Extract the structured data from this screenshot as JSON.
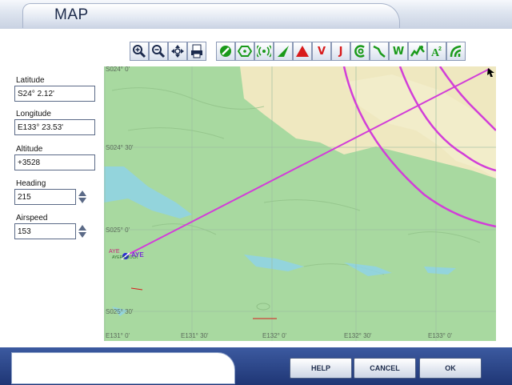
{
  "window": {
    "title": "MAP"
  },
  "toolbar": {
    "buttons": [
      {
        "name": "zoom-in-icon"
      },
      {
        "name": "zoom-out-icon"
      },
      {
        "name": "center-aircraft-icon"
      },
      {
        "name": "print-icon"
      },
      {
        "name": "airport-filter-icon",
        "color": "#1a9a1a"
      },
      {
        "name": "vor-filter-icon",
        "color": "#1a9a1a"
      },
      {
        "name": "ndb-filter-icon",
        "color": "#1a9a1a"
      },
      {
        "name": "ils-filter-icon",
        "color": "#1a9a1a"
      },
      {
        "name": "intersection-filter-icon",
        "color": "#d81b1b"
      },
      {
        "name": "victor-airways-filter-icon",
        "glyph": "V",
        "color": "#d81b1b"
      },
      {
        "name": "jet-airways-filter-icon",
        "glyph": "J",
        "color": "#d81b1b"
      },
      {
        "name": "airspace-filter-icon",
        "color": "#1a9a1a"
      },
      {
        "name": "route-filter-icon",
        "color": "#1a9a1a"
      },
      {
        "name": "weather-filter-icon",
        "glyph": "W",
        "color": "#1a9a1a"
      },
      {
        "name": "terrain-filter-icon",
        "color": "#1a9a1a"
      },
      {
        "name": "altitude-filter-icon",
        "color": "#1a9a1a"
      },
      {
        "name": "towers-filter-icon",
        "color": "#1a9a1a"
      }
    ]
  },
  "fields": {
    "latitude": {
      "label": "Latitude",
      "value": "S24° 2.12'"
    },
    "longitude": {
      "label": "Longitude",
      "value": "E133° 23.53'"
    },
    "altitude": {
      "label": "Altitude",
      "value": "+3528"
    },
    "heading": {
      "label": "Heading",
      "value": "215"
    },
    "airspeed": {
      "label": "Airspeed",
      "value": "153"
    }
  },
  "map": {
    "lat_labels": [
      "S024° 30'",
      "S025° 0'",
      "S025° 30'"
    ],
    "lon_labels": [
      "E131° 0'",
      "E131° 30'",
      "E132° 0'",
      "E132° 30'",
      "E133° 0'"
    ],
    "corner_label": "S024° 0'",
    "airport": {
      "label": "AYE",
      "sub_label": "AYERS ROCK",
      "label2": "AYE"
    },
    "colors": {
      "terrain": "#a8d9a0",
      "desert": "#f1ecc4",
      "route": "#d23ed8",
      "water": "#8fd2e6"
    }
  },
  "buttons": {
    "help": "HELP",
    "cancel": "CANCEL",
    "ok": "OK"
  }
}
